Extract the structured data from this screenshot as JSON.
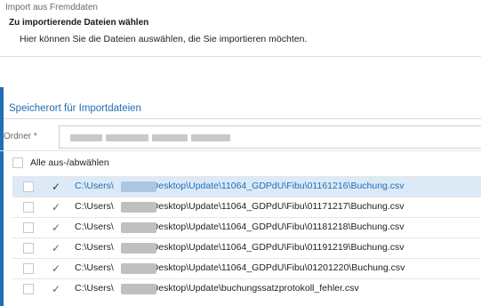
{
  "window": {
    "title": "Import aus Fremddaten"
  },
  "header": {
    "title": "Zu importierende Dateien wählen",
    "subtitle": "Hier können Sie die Dateien auswählen, die Sie importieren möchten."
  },
  "section": {
    "title": "Speicherort für Importdateien"
  },
  "folder": {
    "label": "Ordner *",
    "value": ""
  },
  "select_all": {
    "label": "Alle aus-/abwählen"
  },
  "files": [
    {
      "prefix": "C:\\Users\\",
      "suffix": "\\Desktop\\Update\\11064_GDPdU\\Fibu\\01161216\\Buchung.csv"
    },
    {
      "prefix": "C:\\Users\\",
      "suffix": "\\Desktop\\Update\\11064_GDPdU\\Fibu\\01171217\\Buchung.csv"
    },
    {
      "prefix": "C:\\Users\\",
      "suffix": "\\Desktop\\Update\\11064_GDPdU\\Fibu\\01181218\\Buchung.csv"
    },
    {
      "prefix": "C:\\Users\\",
      "suffix": "\\Desktop\\Update\\11064_GDPdU\\Fibu\\01191219\\Buchung.csv"
    },
    {
      "prefix": "C:\\Users\\",
      "suffix": "\\Desktop\\Update\\11064_GDPdU\\Fibu\\01201220\\Buchung.csv"
    },
    {
      "prefix": "C:\\Users\\",
      "suffix": "\\Desktop\\Update\\buchungssatzprotokoll_fehler.csv"
    }
  ],
  "colors": {
    "accent": "#1f6fb3",
    "selected_row": "#dceaf7"
  }
}
